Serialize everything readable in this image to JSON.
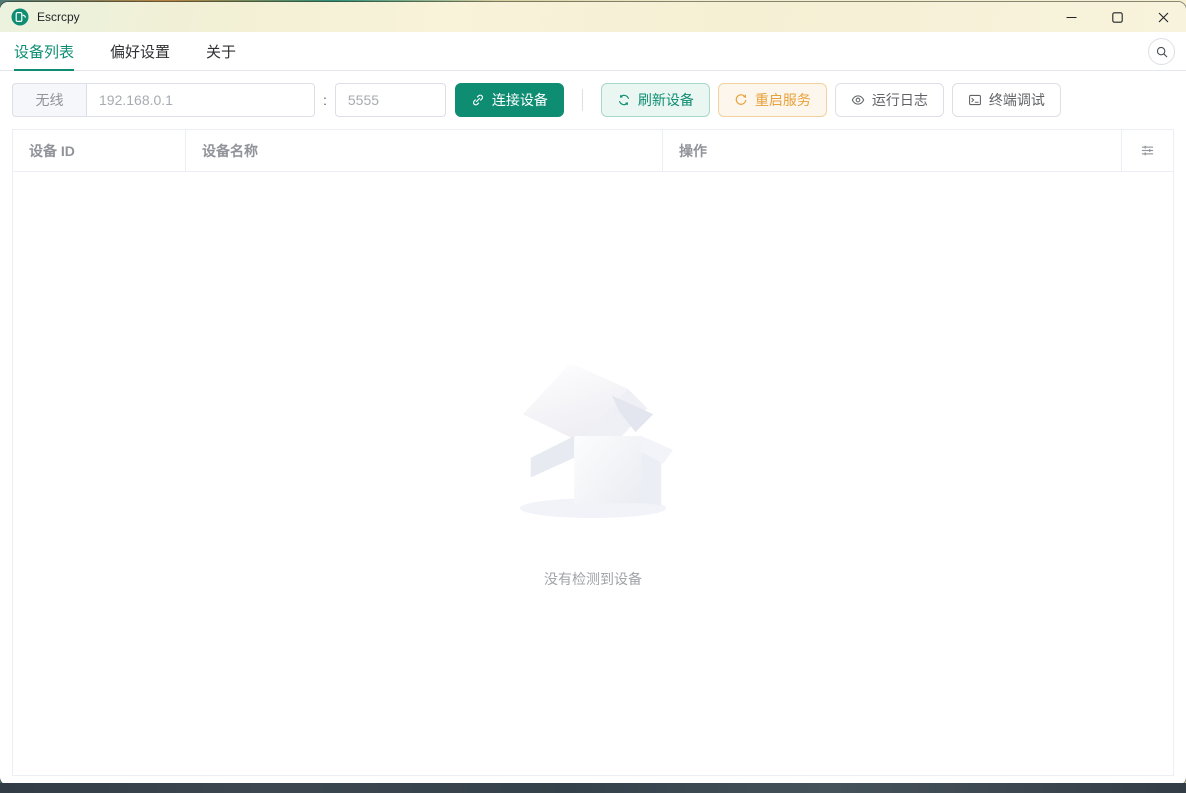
{
  "window": {
    "title": "Escrcpy"
  },
  "tabs": [
    {
      "label": "设备列表",
      "active": true
    },
    {
      "label": "偏好设置",
      "active": false
    },
    {
      "label": "关于",
      "active": false
    }
  ],
  "toolbar": {
    "wireless_label": "无线",
    "ip_placeholder": "192.168.0.1",
    "port_separator": ":",
    "port_placeholder": "5555",
    "connect_label": "连接设备",
    "refresh_label": "刷新设备",
    "restart_label": "重启服务",
    "logs_label": "运行日志",
    "terminal_label": "终端调试"
  },
  "device_table": {
    "columns": [
      "设备 ID",
      "设备名称",
      "操作"
    ],
    "rows": [],
    "empty_text": "没有检测到设备"
  },
  "colors": {
    "primary": "#0e8d73",
    "warning": "#e6a23c",
    "success_plain_bg": "#eaf6f1",
    "warning_plain_bg": "#fdf6ec"
  }
}
